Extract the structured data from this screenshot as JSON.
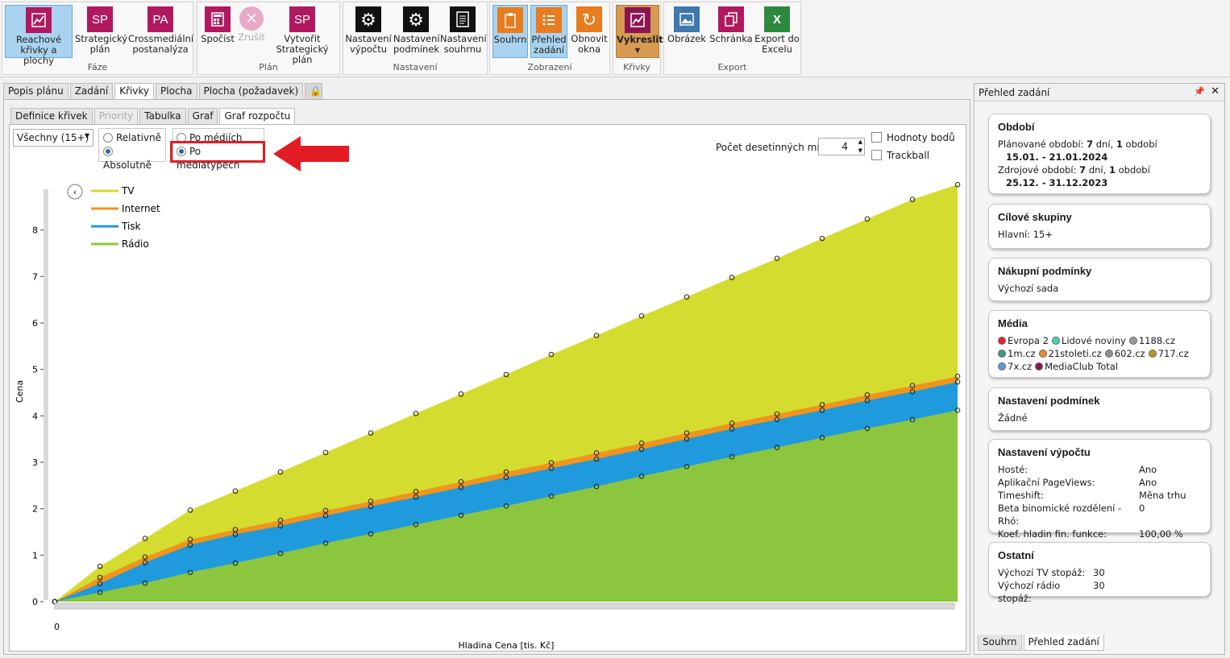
{
  "ribbon": {
    "groups": [
      {
        "label": "Fáze",
        "buttons": [
          {
            "label": "Reachové křivky a plochy",
            "icon_text": "",
            "active": true
          },
          {
            "label": "Strategický plán",
            "icon_text": "SP"
          },
          {
            "label": "Crossmediální postanalýza",
            "icon_text": "PA"
          }
        ]
      },
      {
        "label": "Plán",
        "buttons": [
          {
            "label": "Spočíst",
            "icon_text": ""
          },
          {
            "label": "Zrušit",
            "icon_text": ""
          },
          {
            "label": "Vytvořit Strategický plán",
            "icon_text": "SP"
          }
        ]
      },
      {
        "label": "Nastavení",
        "buttons": [
          {
            "label": "Nastavení výpočtu",
            "icon_text": ""
          },
          {
            "label": "Nastavení podmínek",
            "icon_text": ""
          },
          {
            "label": "Nastavení souhrnu",
            "icon_text": ""
          }
        ]
      },
      {
        "label": "Zobrazení",
        "buttons": [
          {
            "label": "Souhrn",
            "icon_text": "",
            "active": true
          },
          {
            "label": "Přehled zadání",
            "icon_text": "",
            "active": true
          },
          {
            "label": "Obnovit okna",
            "icon_text": ""
          }
        ]
      },
      {
        "label": "Křivky",
        "buttons": [
          {
            "label": "Vykreslit",
            "icon_text": ""
          }
        ]
      },
      {
        "label": "Export",
        "buttons": [
          {
            "label": "Obrázek",
            "icon_text": ""
          },
          {
            "label": "Schránka",
            "icon_text": ""
          },
          {
            "label": "Export do Excelu",
            "icon_text": "X"
          }
        ]
      }
    ]
  },
  "main_tabs": [
    "Popis plánu",
    "Zadání",
    "Křivky",
    "Plocha",
    "Plocha (požadavek)"
  ],
  "sub_tabs": [
    "Definice křivek",
    "Priority",
    "Tabulka",
    "Graf",
    "Graf rozpočtu"
  ],
  "controls": {
    "target_group": "Všechny (15+)",
    "mode_relative": "Relativně",
    "mode_absolute": "Absolutně",
    "by_media": "Po médiích",
    "by_mediatypes": "Po médiatypech",
    "decimals_label": "Počet desetinných míst:",
    "decimals_value": "4",
    "point_values": "Hodnoty bodů",
    "trackball": "Trackball"
  },
  "chart_data": {
    "type": "area",
    "xlabel": "Hladina Cena [tis. Kč]",
    "ylabel": "Cena",
    "x_tick_label": "0",
    "ylim": [
      0,
      9
    ],
    "yticks": [
      "0",
      "1",
      "2",
      "3",
      "4",
      "5",
      "6",
      "7",
      "8"
    ],
    "stacked": true,
    "legend": [
      "TV",
      "Internet",
      "Tisk",
      "Rádio"
    ],
    "colors": {
      "TV": "#d4dd2f",
      "Internet": "#f0941e",
      "Tisk": "#1f9adc",
      "Rádio": "#8cc63f"
    },
    "cumulative_series": {
      "Rádio": [
        0,
        0.2,
        0.4,
        0.63,
        0.83,
        1.04,
        1.26,
        1.46,
        1.66,
        1.86,
        2.06,
        2.27,
        2.48,
        2.7,
        2.91,
        3.12,
        3.32,
        3.53,
        3.73,
        3.92,
        4.12
      ],
      "Tisk": [
        0,
        0.39,
        0.84,
        1.22,
        1.45,
        1.63,
        1.85,
        2.05,
        2.25,
        2.46,
        2.67,
        2.87,
        3.07,
        3.28,
        3.5,
        3.72,
        3.92,
        4.12,
        4.33,
        4.52,
        4.73
      ],
      "Internet": [
        0,
        0.52,
        0.96,
        1.34,
        1.55,
        1.75,
        1.96,
        2.16,
        2.37,
        2.58,
        2.79,
        2.99,
        3.2,
        3.41,
        3.63,
        3.84,
        4.04,
        4.24,
        4.45,
        4.65,
        4.85
      ],
      "TV": [
        0,
        0.76,
        1.36,
        1.97,
        2.38,
        2.79,
        3.21,
        3.63,
        4.05,
        4.47,
        4.89,
        5.32,
        5.73,
        6.15,
        6.56,
        6.98,
        7.39,
        7.82,
        8.24,
        8.66,
        8.98
      ]
    },
    "grid": false,
    "legend_position": "top-left"
  },
  "side_panel": {
    "title": "Přehled zadání",
    "cards": {
      "obdobi": {
        "title": "Období",
        "planned_label": "Plánované období:",
        "planned_days": "7",
        "planned_days_word": "dní,",
        "planned_count": "1",
        "planned_count_word": "období",
        "planned_range": "15.01. - 21.01.2024",
        "source_label": "Zdrojové období:",
        "source_days": "7",
        "source_days_word": "dní,",
        "source_count": "1",
        "source_count_word": "období",
        "source_range": "25.12. - 31.12.2023"
      },
      "cilove": {
        "title": "Cílové skupiny",
        "line": "Hlavní:  15+"
      },
      "nakupni": {
        "title": "Nákupní podmínky",
        "line": "Výchozí sada"
      },
      "media": {
        "title": "Média",
        "items": [
          {
            "name": "Evropa 2",
            "color": "#e5202f"
          },
          {
            "name": "Lidové noviny",
            "color": "#3fd6b0"
          },
          {
            "name": "1188.cz",
            "color": "#9a9a9a"
          },
          {
            "name": "1m.cz",
            "color": "#3e9c7f"
          },
          {
            "name": "21stoleti.cz",
            "color": "#e8892a"
          },
          {
            "name": "602.cz",
            "color": "#8f8f8f"
          },
          {
            "name": "717.cz",
            "color": "#b39a1f"
          },
          {
            "name": "7x.cz",
            "color": "#5b9be0"
          },
          {
            "name": "MediaClub Total",
            "color": "#8a1550"
          }
        ]
      },
      "podminky": {
        "title": "Nastavení podmínek",
        "line": "Žádné"
      },
      "vypocet": {
        "title": "Nastavení výpočtu",
        "rows": [
          {
            "k": "Hosté:",
            "v": "Ano"
          },
          {
            "k": "Aplikační PageViews:",
            "v": "Ano"
          },
          {
            "k": "Timeshift:",
            "v": "Měna trhu"
          },
          {
            "k": "Beta binomické rozdělení - Rhó:",
            "v": "0"
          },
          {
            "k": "Koef. hladin fin. funkce:",
            "v": "100,00 %"
          }
        ]
      },
      "ostatni": {
        "title": "Ostatní",
        "rows": [
          {
            "k": "Výchozí TV stopáž:",
            "v": "30"
          },
          {
            "k": "Výchozí rádio stopáž:",
            "v": "30"
          }
        ]
      }
    },
    "bottom_tabs": [
      "Souhrn",
      "Přehled zadání"
    ]
  }
}
